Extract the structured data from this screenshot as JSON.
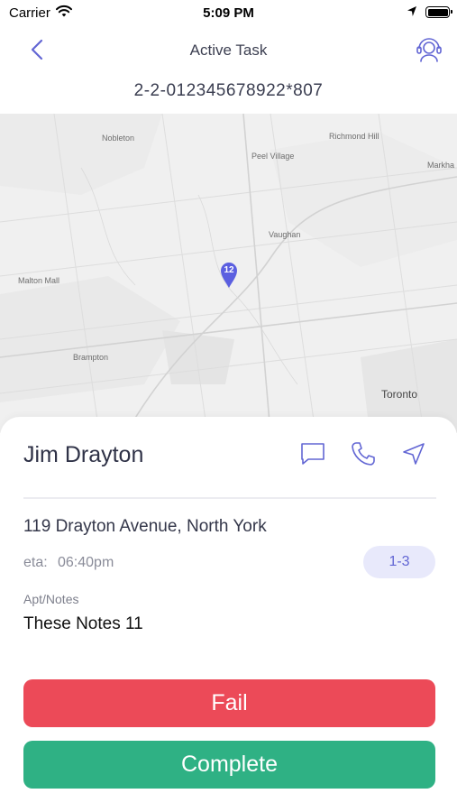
{
  "status_bar": {
    "carrier": "Carrier",
    "time": "5:09 PM",
    "icons": [
      "wifi-icon",
      "location-arrow-icon",
      "battery-icon"
    ]
  },
  "header": {
    "title": "Active Task",
    "back_icon": "chevron-left-icon",
    "support_icon": "headset-support-icon",
    "task_id": "2-2-012345678922*807"
  },
  "map": {
    "labels": [
      "Richmond Hill",
      "Markha",
      "Vaughan",
      "Brampton",
      "Toronto",
      "Peel Village",
      "Nobleton",
      "Malton Mall"
    ],
    "marker": "12",
    "marker_color": "#5b5fe0"
  },
  "task": {
    "customer_name": "Jim Drayton",
    "actions": [
      "message-icon",
      "phone-icon",
      "navigate-icon"
    ],
    "address": "119 Drayton Avenue, North York",
    "eta_label": "eta:",
    "eta_value": "06:40pm",
    "stop_badge": "1-3",
    "notes_label": "Apt/Notes",
    "notes_value": "These Notes 11"
  },
  "buttons": {
    "fail": "Fail",
    "complete": "Complete"
  },
  "colors": {
    "accent": "#6266d4",
    "fail": "#ec4a58",
    "complete": "#2fb184",
    "badge_bg": "#e8e9fb"
  }
}
